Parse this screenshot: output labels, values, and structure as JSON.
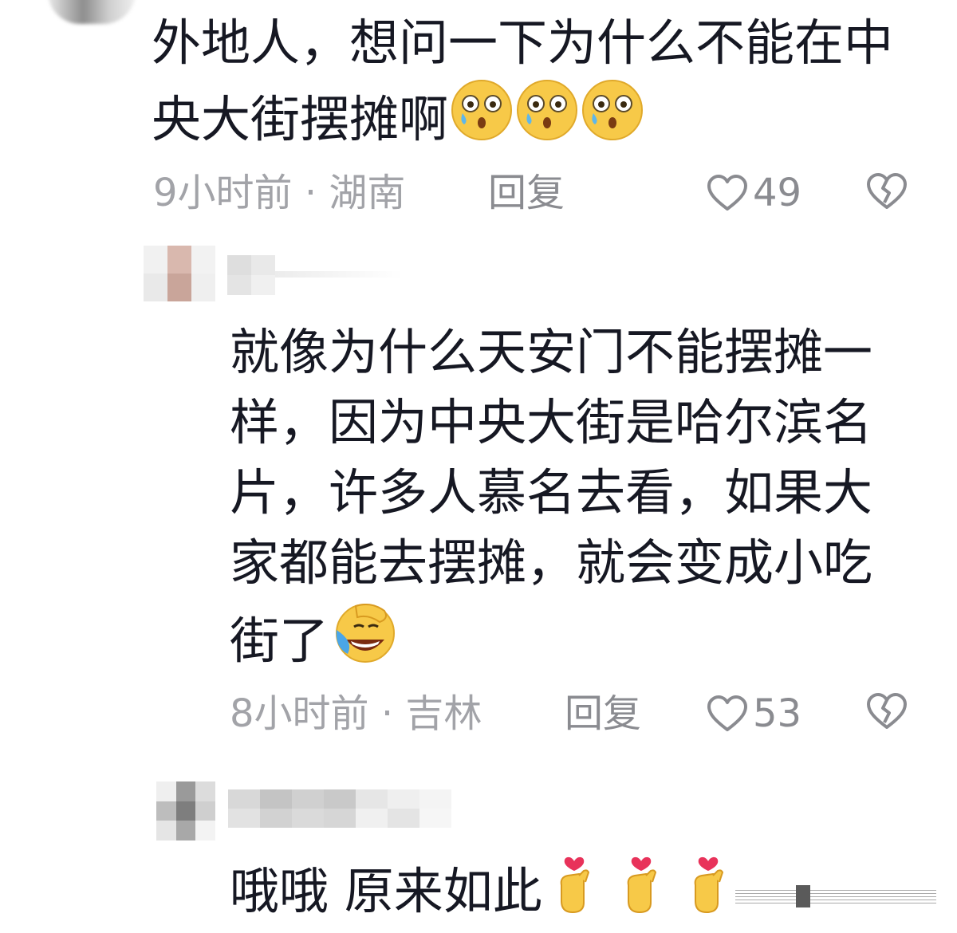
{
  "comments": [
    {
      "text": "外地人，想问一下为什么不能在中央大街摆摊啊",
      "line1": "外地人，想问一下为什么不能在中",
      "line2": "央大街摆摊啊",
      "emoji": [
        "shocked-tear-face-icon",
        "shocked-tear-face-icon",
        "shocked-tear-face-icon"
      ],
      "time": "9小时前",
      "location": "湖南",
      "reply_label": "回复",
      "likes": "49"
    },
    {
      "lines": [
        "就像为什么天安门不能摆摊一",
        "样，因为中央大街是哈尔滨名",
        "片，许多人慕名去看，如果大",
        "家都能去摆摊，就会变成小吃",
        "街了"
      ],
      "emoji": [
        "facepalm-laugh-icon"
      ],
      "time": "8小时前",
      "location": "吉林",
      "reply_label": "回复",
      "likes": "53"
    },
    {
      "text": "哦哦 原来如此",
      "emoji": [
        "finger-heart-icon",
        "finger-heart-icon",
        "finger-heart-icon"
      ]
    }
  ],
  "colors": {
    "text": "#161823",
    "meta": "#a2a3a8",
    "emoji_yellow": "#f7c948",
    "heart_pink": "#e8325a"
  }
}
